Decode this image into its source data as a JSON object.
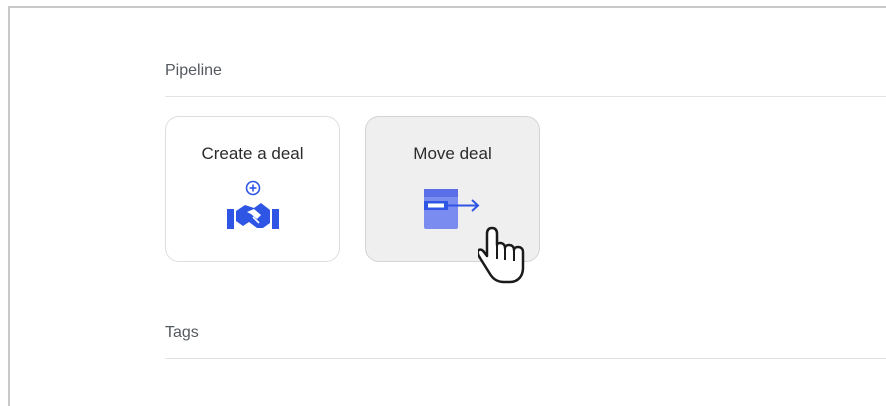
{
  "sections": {
    "pipeline_label": "Pipeline",
    "tags_label": "Tags"
  },
  "cards": {
    "create_deal": {
      "label": "Create a deal",
      "icon": "handshake-plus-icon"
    },
    "move_deal": {
      "label": "Move deal",
      "icon": "move-card-arrow-icon",
      "state": "hover"
    }
  },
  "colors": {
    "accent": "#2f55e4",
    "accent_light": "#7b8cf0",
    "card_hover_bg": "#efefef"
  }
}
